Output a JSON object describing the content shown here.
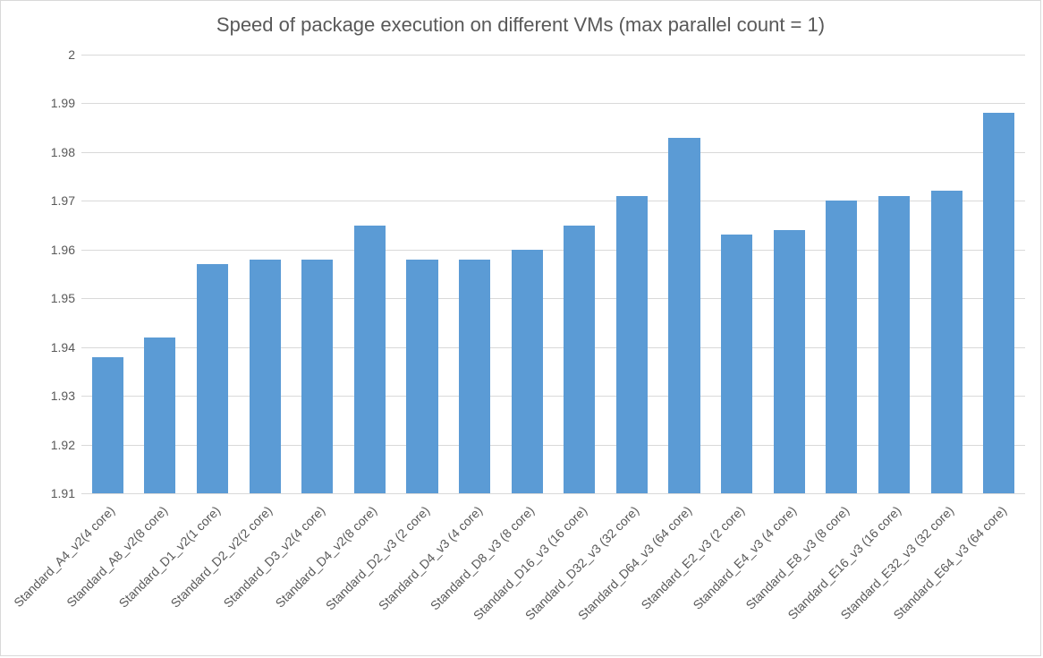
{
  "chart_data": {
    "type": "bar",
    "title": "Speed of package execution on different VMs (max parallel count = 1)",
    "xlabel": "",
    "ylabel": "",
    "ylim": [
      1.91,
      2.0
    ],
    "yticks": [
      1.91,
      1.92,
      1.93,
      1.94,
      1.95,
      1.96,
      1.97,
      1.98,
      1.99,
      2.0
    ],
    "categories": [
      "Standard_A4_v2(4 core)",
      "Standard_A8_v2(8 core)",
      "Standard_D1_v2(1 core)",
      "Standard_D2_v2(2 core)",
      "Standard_D3_v2(4 core)",
      "Standard_D4_v2(8 core)",
      "Standard_D2_v3 (2 core)",
      "Standard_D4_v3 (4 core)",
      "Standard_D8_v3 (8 core)",
      "Standard_D16_v3 (16 core)",
      "Standard_D32_v3 (32 core)",
      "Standard_D64_v3 (64 core)",
      "Standard_E2_v3 (2 core)",
      "Standard_E4_v3 (4 core)",
      "Standard_E8_v3 (8 core)",
      "Standard_E16_v3 (16 core)",
      "Standard_E32_v3 (32 core)",
      "Standard_E64_v3 (64 core)"
    ],
    "values": [
      1.938,
      1.942,
      1.957,
      1.958,
      1.958,
      1.965,
      1.958,
      1.958,
      1.96,
      1.965,
      1.971,
      1.983,
      1.963,
      1.964,
      1.97,
      1.971,
      1.972,
      1.988
    ],
    "bar_color": "#5b9bd5",
    "grid_color": "#d9d9d9",
    "text_color": "#595959"
  }
}
